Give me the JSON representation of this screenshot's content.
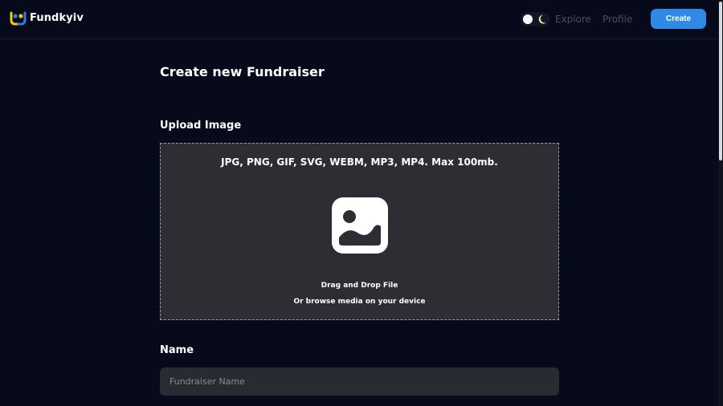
{
  "brand": {
    "name": "Fundkyiv",
    "logo_icon": "fundkyiv-logo-icon"
  },
  "nav": {
    "theme_toggle_icons": [
      "sun-icon",
      "moon-icon"
    ],
    "explore_label": "Explore",
    "profile_label": "Profile",
    "create_label": "Create"
  },
  "page": {
    "title": "Create new Fundraiser"
  },
  "upload": {
    "label": "Upload Image",
    "formats": "JPG, PNG, GIF, SVG, WEBM, MP3, MP4. Max 100mb.",
    "icon": "image-icon",
    "drag_text": "Drag and Drop File",
    "browse_text": "Or browse media on your device"
  },
  "name_field": {
    "label": "Name",
    "placeholder": "Fundraiser Name",
    "value": ""
  },
  "colors": {
    "background": "#060a1a",
    "accent": "#2f8ae6",
    "dropzone": "#2d2d33",
    "input": "#2a2b31"
  }
}
